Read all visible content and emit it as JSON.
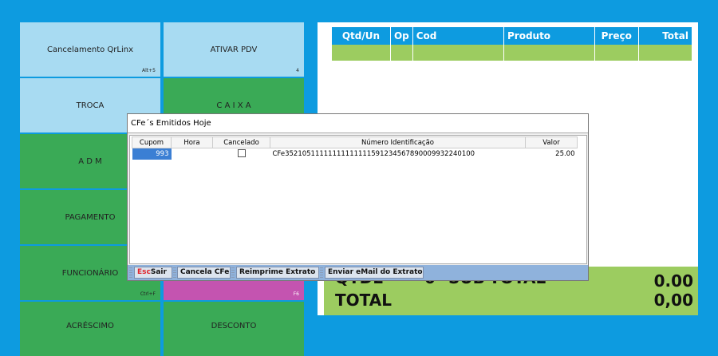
{
  "tiles": {
    "cancel_qrlinx": {
      "label": "Cancelamento QrLinx",
      "key": "Alt+5"
    },
    "ativar_pdv": {
      "label": "ATIVAR PDV",
      "key": "4"
    },
    "troca": {
      "label": "TROCA"
    },
    "caixa": {
      "label": "C A I X A"
    },
    "adm": {
      "label": "A D M"
    },
    "pagamento": {
      "label": "PAGAMENTO"
    },
    "funcionario": {
      "label": "FUNCIONÁRIO",
      "key": "Ctrl+F"
    },
    "pink": {
      "key": "F6"
    },
    "acrescimo": {
      "label": "ACRÉSCIMO"
    },
    "desconto": {
      "label": "DESCONTO"
    }
  },
  "sales_grid": {
    "columns": [
      "Qtd/Un",
      "Op",
      "Cod",
      "Produto",
      "Preço",
      "Total"
    ]
  },
  "totals": {
    "qtde_label": "QTDE",
    "qtde_value": "0",
    "subtotal_label": "SUB-TOTAL",
    "subtotal_value": "0.00",
    "total_label": "TOTAL",
    "total_value": "0,00"
  },
  "dialog": {
    "title": "CFe´s Emitidos Hoje",
    "columns": [
      "Cupom",
      "Hora",
      "Cancelado",
      "Número Identificação",
      "Valor"
    ],
    "rows": [
      {
        "cupom": "993",
        "hora": "",
        "cancelado": false,
        "numero": "CFe35210511111111111111591234567890009932240100",
        "valor": "25.00"
      }
    ],
    "buttons": {
      "sair_key": "Esc",
      "sair": "Sair",
      "cancela": "Cancela CFe",
      "reimprime": "Reimprime Extrato",
      "email": "Enviar eMail do Extrato"
    }
  },
  "colors": {
    "background": "#0d9be0",
    "tile_light": "#a8dbf2",
    "tile_green": "#3aaa56",
    "tile_pink": "#c454b0",
    "totals_green": "#9ccc60"
  }
}
